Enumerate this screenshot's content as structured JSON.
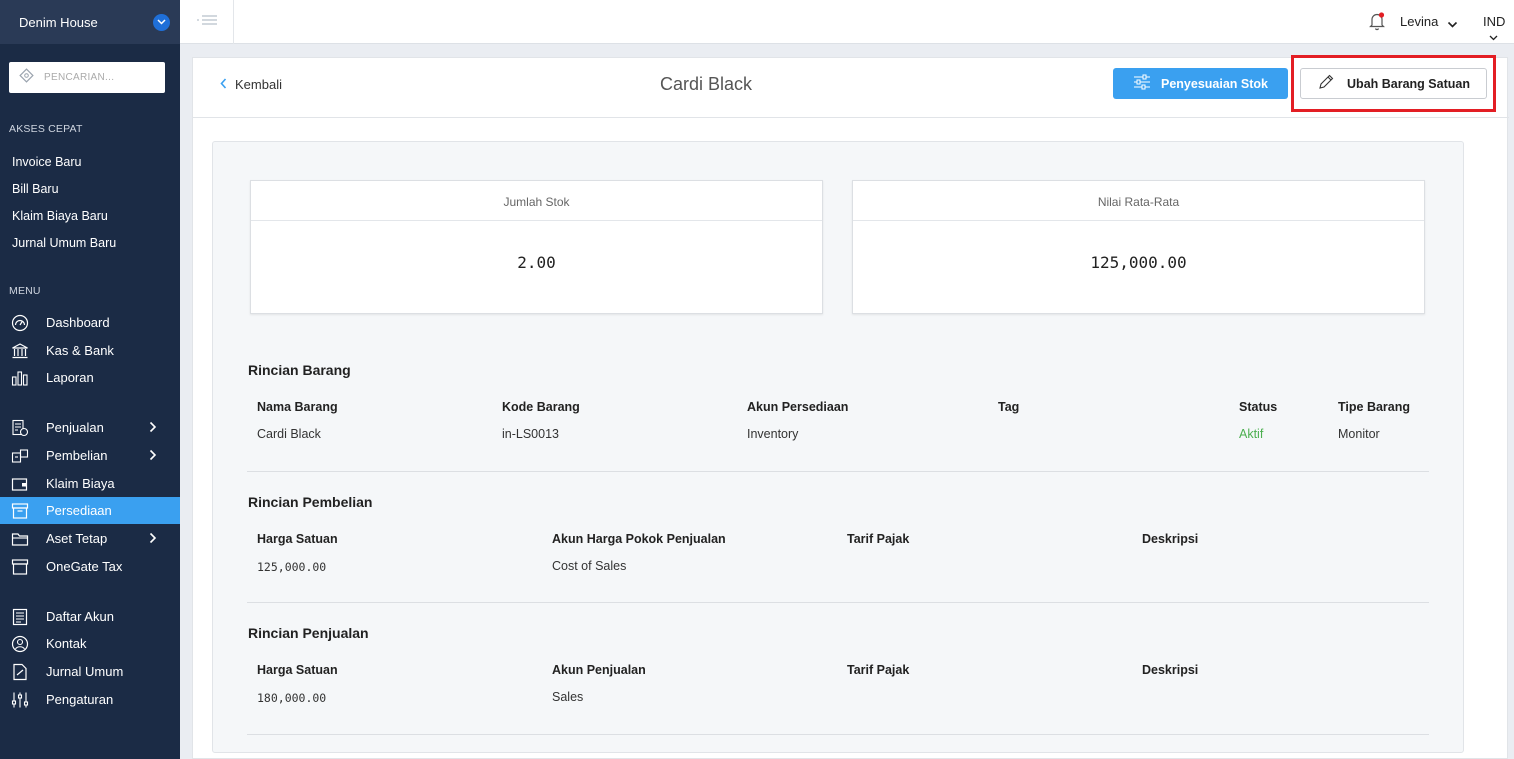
{
  "sidebar": {
    "company": "Denim House",
    "search_placeholder": "PENCARIAN...",
    "quick_access_label": "AKSES CEPAT",
    "quick_links": [
      "Invoice Baru",
      "Bill Baru",
      "Klaim Biaya Baru",
      "Jurnal Umum Baru"
    ],
    "menu_label": "MENU",
    "menu": [
      {
        "label": "Dashboard",
        "icon": "dashboard-icon"
      },
      {
        "label": "Kas & Bank",
        "icon": "bank-icon"
      },
      {
        "label": "Laporan",
        "icon": "report-icon"
      },
      {
        "label": "Penjualan",
        "icon": "sales-icon",
        "has_submenu": true
      },
      {
        "label": "Pembelian",
        "icon": "purchase-icon",
        "has_submenu": true
      },
      {
        "label": "Klaim Biaya",
        "icon": "wallet-icon"
      },
      {
        "label": "Persediaan",
        "icon": "inventory-icon",
        "active": true
      },
      {
        "label": "Aset Tetap",
        "icon": "folder-icon",
        "has_submenu": true
      },
      {
        "label": "OneGate Tax",
        "icon": "tax-icon"
      },
      {
        "label": "Daftar Akun",
        "icon": "account-list-icon"
      },
      {
        "label": "Kontak",
        "icon": "contact-icon"
      },
      {
        "label": "Jurnal Umum",
        "icon": "journal-icon"
      },
      {
        "label": "Pengaturan",
        "icon": "settings-icon"
      }
    ]
  },
  "topbar": {
    "user": "Levina",
    "language": "IND"
  },
  "header": {
    "back_label": "Kembali",
    "title": "Cardi Black",
    "adjust_button": "Penyesuaian Stok",
    "edit_button": "Ubah Barang Satuan"
  },
  "stats": {
    "stock_label": "Jumlah Stok",
    "stock_value": "2.00",
    "avg_label": "Nilai Rata-Rata",
    "avg_value": "125,000.00"
  },
  "item_details": {
    "title": "Rincian Barang",
    "headers": [
      "Nama Barang",
      "Kode Barang",
      "Akun Persediaan",
      "Tag",
      "Status",
      "Tipe Barang"
    ],
    "values": [
      "Cardi Black",
      "in-LS0013",
      "Inventory",
      "",
      "Aktif",
      "Monitor"
    ]
  },
  "purchase_details": {
    "title": "Rincian Pembelian",
    "headers": [
      "Harga Satuan",
      "Akun Harga Pokok Penjualan",
      "Tarif Pajak",
      "Deskripsi"
    ],
    "values": [
      "125,000.00",
      "Cost of Sales",
      "",
      ""
    ]
  },
  "sales_details": {
    "title": "Rincian Penjualan",
    "headers": [
      "Harga Satuan",
      "Akun Penjualan",
      "Tarif Pajak",
      "Deskripsi"
    ],
    "values": [
      "180,000.00",
      "Sales",
      "",
      ""
    ]
  },
  "colors": {
    "sidebar_bg": "#1b2b45",
    "accent": "#3aa0f0",
    "highlight": "#e31e24",
    "status_active": "#4caf50"
  }
}
